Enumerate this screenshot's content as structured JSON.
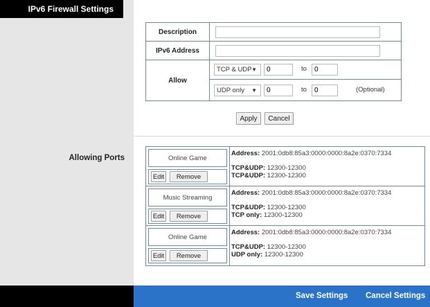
{
  "sidebar": {
    "section_title": "IPv6 Firewall Settings",
    "allowing_ports_label": "Allowing Ports"
  },
  "form": {
    "description_label": "Description",
    "description_value": "",
    "ipv6_address_label": "IPv6 Address",
    "ipv6_address_value": "",
    "allow_label": "Allow",
    "rows": [
      {
        "protocol": "TCP & UDP",
        "from": "0",
        "to_label": "to",
        "to": "0",
        "note": ""
      },
      {
        "protocol": "UDP only",
        "from": "0",
        "to_label": "to",
        "to": "0",
        "note": "(Optional)"
      }
    ],
    "apply_label": "Apply",
    "cancel_label": "Cancel"
  },
  "rules": [
    {
      "name": "Online Game",
      "address_label": "Address:",
      "address": "2001:0db8:85a3:0000:0000:8a2e:0370:7334",
      "line1_label": "TCP&UDP:",
      "line1_value": "12300-12300",
      "line2_label": "TCP&UDP:",
      "line2_value": "12300-12300",
      "edit_label": "Edit",
      "remove_label": "Remove"
    },
    {
      "name": "Music Streaming",
      "address_label": "Address:",
      "address": "2001:0db8:85a3:0000:0000:8a2e:0370:7334",
      "line1_label": "TCP&UDP:",
      "line1_value": "12300-12300",
      "line2_label": "TCP only:",
      "line2_value": "12300-12300",
      "edit_label": "Edit",
      "remove_label": "Remove"
    },
    {
      "name": "Online Game",
      "address_label": "Address:",
      "address": "2001:0db8:85a3:0000:0000:8a2e:0370:7334",
      "line1_label": "TCP&UDP:",
      "line1_value": "12300-12300",
      "line2_label": "UDP only:",
      "line2_value": "12300-12300",
      "edit_label": "Edit",
      "remove_label": "Remove"
    }
  ],
  "footer": {
    "save_label": "Save Settings",
    "cancel_label": "Cancel Settings"
  },
  "colors": {
    "accent_blue": "#2b73c9",
    "table_border": "#6a8ab5",
    "sidebar_bg": "#e6e6e6"
  },
  "icons": {
    "dropdown": "chevron-down-icon"
  }
}
